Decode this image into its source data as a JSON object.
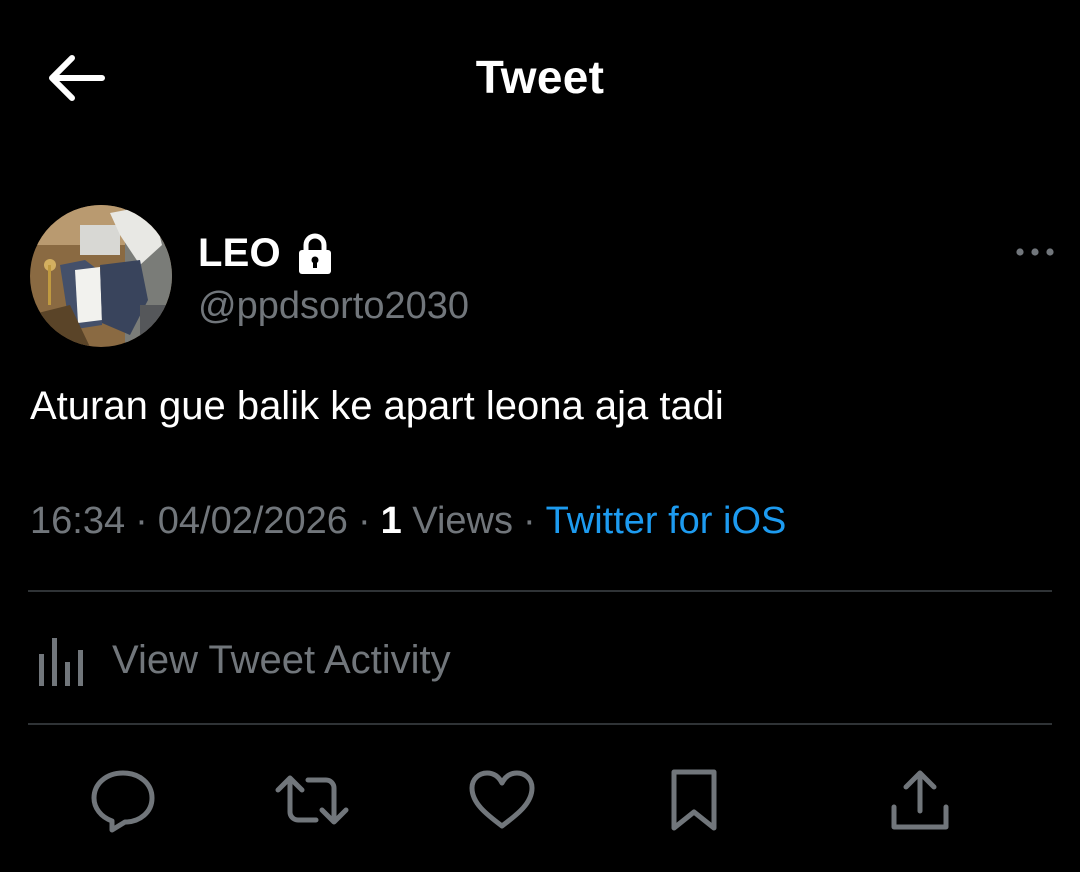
{
  "header": {
    "title": "Tweet",
    "back_icon": "arrow-left-icon"
  },
  "author": {
    "display_name": "LEO",
    "handle": "@ppdsorto2030",
    "protected_icon": "lock-icon",
    "more_icon": "more-horizontal-icon"
  },
  "tweet": {
    "text": "Aturan gue balik ke apart leona aja tadi"
  },
  "meta": {
    "time": "16:34",
    "date": "04/02/2026",
    "separator": "·",
    "views_count": "1",
    "views_label": "Views",
    "source": "Twitter for iOS"
  },
  "activity": {
    "label": "View Tweet Activity",
    "icon": "analytics-bars-icon"
  },
  "actions": [
    {
      "name": "reply",
      "icon": "reply-bubble-icon"
    },
    {
      "name": "retweet",
      "icon": "retweet-icon"
    },
    {
      "name": "like",
      "icon": "heart-icon"
    },
    {
      "name": "bookmark",
      "icon": "bookmark-icon"
    },
    {
      "name": "share",
      "icon": "share-upload-icon"
    }
  ],
  "colors": {
    "background": "#000000",
    "primary_text": "#ffffff",
    "secondary_text": "#71767b",
    "link": "#1d9bf0",
    "divider": "#2f3336"
  }
}
